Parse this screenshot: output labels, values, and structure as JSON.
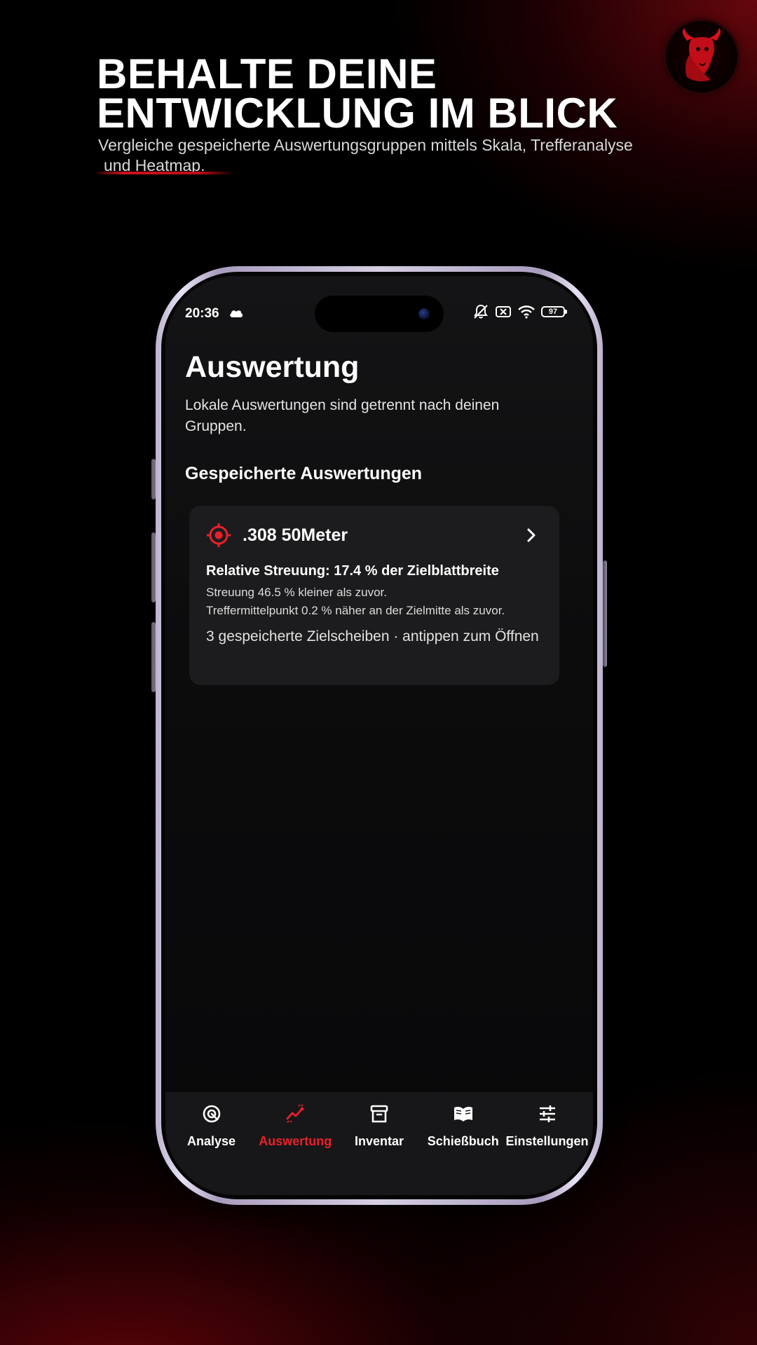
{
  "promo": {
    "headline_line1": "BEHALTE DEINE",
    "headline_line2": "ENTWICKLUNG IM BLICK",
    "subline_line1": "Vergleiche gespeicherte Auswertungsgruppen mittels Skala, Trefferanalyse",
    "subline_line2": "und Heatmap.",
    "logo_icon": "bull-head-icon"
  },
  "status_bar": {
    "time": "20:36",
    "battery": "97",
    "icons": [
      "cloud-icon",
      "muted-bell-icon",
      "sim-off-icon",
      "wifi-icon",
      "battery-icon"
    ]
  },
  "screen": {
    "title": "Auswertung",
    "description": "Lokale Auswertungen sind getrennt nach deinen Gruppen.",
    "section_title": "Gespeicherte Auswertungen"
  },
  "card": {
    "icon": "crosshair-icon",
    "title": ".308 50Meter",
    "headline": "Relative Streuung: 17.4 % der Zielblattbreite",
    "line1": "Streuung 46.5 % kleiner als zuvor.",
    "line2": "Treffermittelpunkt 0.2 % näher an der Zielmitte als zuvor.",
    "footer": "3 gespeicherte Zielscheiben · antippen zum Öffnen"
  },
  "nav": {
    "items": [
      {
        "label": "Analyse",
        "icon": "target-icon"
      },
      {
        "label": "Auswertung",
        "icon": "chart-trend-icon",
        "active": true
      },
      {
        "label": "Inventar",
        "icon": "archive-box-icon"
      },
      {
        "label": "Schießbuch",
        "icon": "open-book-icon"
      },
      {
        "label": "Einstellungen",
        "icon": "sliders-icon"
      }
    ]
  },
  "colors": {
    "accent_red": "#e8202a",
    "card_bg": "#1c1c1e",
    "screen_bg": "#0c0c0d"
  }
}
